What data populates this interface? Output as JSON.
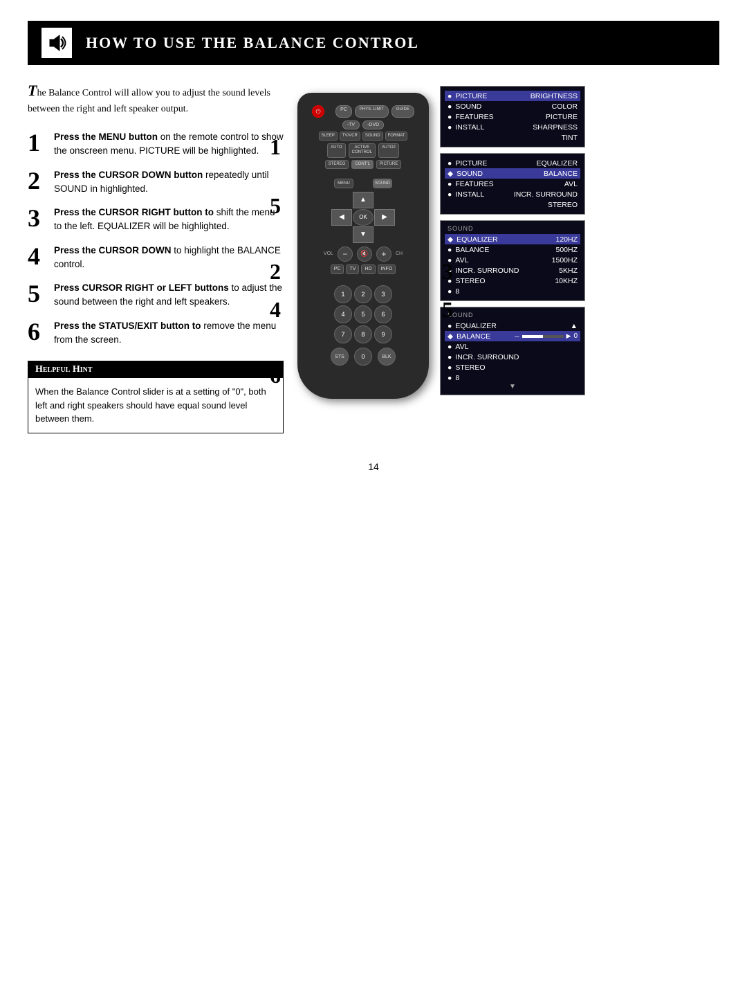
{
  "header": {
    "title": "How to Use the Balance Control",
    "icon_label": "speaker-icon"
  },
  "intro": {
    "drop_cap": "T",
    "text": "he Balance Control will allow you to adjust the sound levels between the right and left speaker output."
  },
  "steps": [
    {
      "number": "1",
      "text_bold": "Press the MENU button",
      "text": " on the remote control to show the onscreen menu. PICTURE will be highlighted."
    },
    {
      "number": "2",
      "text_bold": "Press the CURSOR DOWN button",
      "text": " repeatedly until SOUND in highlighted."
    },
    {
      "number": "3",
      "text_bold": "Press the CURSOR RIGHT button to",
      "text": " shift the menu to the left. EQUALIZER will be highlighted."
    },
    {
      "number": "4",
      "text_bold": "Press the CURSOR DOWN",
      "text": " to highlight the BALANCE control."
    },
    {
      "number": "5",
      "text_bold": "Press CURSOR RIGHT or LEFT buttons",
      "text": " to adjust the sound between the right and left speakers."
    },
    {
      "number": "6",
      "text_bold": "Press the STATUS/EXIT button to",
      "text": " remove the menu from the screen."
    }
  ],
  "helpful_hint": {
    "title": "Helpful Hint",
    "text": "When the Balance Control slider is at a setting of \"0\", both left and right speakers should have equal sound level between them."
  },
  "menu_screen_1": {
    "label": "",
    "items": [
      {
        "bullet": "●",
        "name": "PICTURE",
        "value": "BRIGHTNESS",
        "active": true
      },
      {
        "bullet": "●",
        "name": "SOUND",
        "value": "COLOR",
        "active": false
      },
      {
        "bullet": "●",
        "name": "FEATURES",
        "value": "PICTURE",
        "active": false
      },
      {
        "bullet": "●",
        "name": "INSTALL",
        "value": "SHARPNESS",
        "active": false
      },
      {
        "bullet": "",
        "name": "",
        "value": "TINT",
        "active": false
      }
    ]
  },
  "menu_screen_2": {
    "label": "",
    "items": [
      {
        "bullet": "●",
        "name": "PICTURE",
        "value": "EQUALIZER",
        "active": false
      },
      {
        "bullet": "◆",
        "name": "SOUND",
        "value": "BALANCE",
        "active": true
      },
      {
        "bullet": "●",
        "name": "FEATURES",
        "value": "AVL",
        "active": false
      },
      {
        "bullet": "●",
        "name": "INSTALL",
        "value": "INCR. SURROUND",
        "active": false
      },
      {
        "bullet": "",
        "name": "",
        "value": "STEREO",
        "active": false
      }
    ]
  },
  "menu_screen_3": {
    "label": "SOUND",
    "items": [
      {
        "bullet": "◆",
        "name": "EQUALIZER",
        "value": "120HZ",
        "active": true
      },
      {
        "bullet": "●",
        "name": "BALANCE",
        "value": "500HZ",
        "active": false
      },
      {
        "bullet": "●",
        "name": "AVL",
        "value": "1500HZ",
        "active": false
      },
      {
        "bullet": "●",
        "name": "INCR. SURROUND",
        "value": "5KHZ",
        "active": false
      },
      {
        "bullet": "●",
        "name": "STEREO",
        "value": "10KHZ",
        "active": false
      },
      {
        "bullet": "●",
        "name": "8",
        "value": "",
        "active": false
      }
    ]
  },
  "menu_screen_4": {
    "label": "SOUND",
    "items": [
      {
        "bullet": "●",
        "name": "EQUALIZER",
        "value": "",
        "active": false
      },
      {
        "bullet": "◆",
        "name": "BALANCE",
        "value": "slider",
        "active": true
      },
      {
        "bullet": "●",
        "name": "AVL",
        "value": "",
        "active": false
      },
      {
        "bullet": "●",
        "name": "INCR. SURROUND",
        "value": "",
        "active": false
      },
      {
        "bullet": "●",
        "name": "STEREO",
        "value": "",
        "active": false
      },
      {
        "bullet": "●",
        "name": "8",
        "value": "",
        "active": false
      }
    ],
    "slider_value": "0"
  },
  "page_number": "14",
  "remote": {
    "step_labels": [
      "1",
      "5",
      "2",
      "4",
      "3",
      "5",
      "6"
    ]
  }
}
